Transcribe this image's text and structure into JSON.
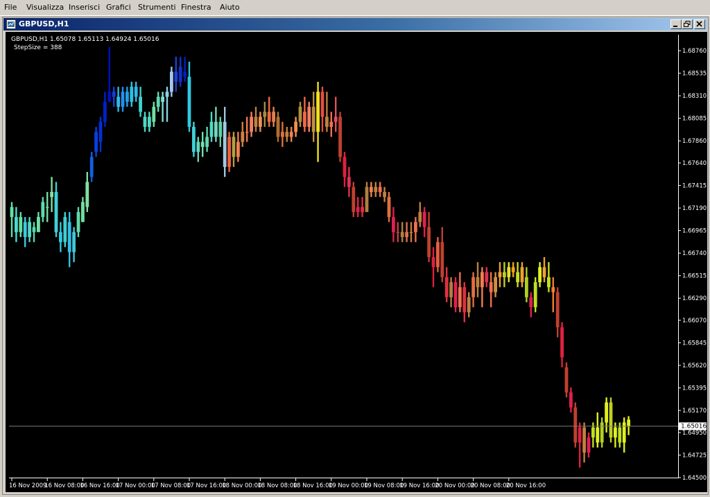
{
  "menu": [
    "File",
    "Visualizza",
    "Inserisci",
    "Grafici",
    "Strumenti",
    "Finestra",
    "Aiuto"
  ],
  "window": {
    "title": "GBPUSD,H1",
    "minimize_icon": "minimize-icon",
    "restore_icon": "restore-icon",
    "close_icon": "close-icon"
  },
  "chart_data": {
    "type": "candlestick",
    "symbol_line": "GBPUSD,H1  1.65078 1.65113 1.64924 1.65016",
    "indicator_line": "StepSize = 388",
    "ylim": [
      1.645,
      1.6892
    ],
    "y_ticks": [
      "1.68760",
      "1.68535",
      "1.68310",
      "1.68085",
      "1.67860",
      "1.67640",
      "1.67415",
      "1.67190",
      "1.66965",
      "1.66740",
      "1.66515",
      "1.66290",
      "1.66070",
      "1.65845",
      "1.65620",
      "1.65395",
      "1.65170",
      "1.64950",
      "1.64725",
      "1.64500"
    ],
    "y_tick_values": [
      1.6876,
      1.68535,
      1.6831,
      1.68085,
      1.6786,
      1.6764,
      1.67415,
      1.6719,
      1.66965,
      1.6674,
      1.66515,
      1.6629,
      1.6607,
      1.65845,
      1.6562,
      1.65395,
      1.6517,
      1.6495,
      1.64725,
      1.645
    ],
    "x_ticks": [
      "16 Nov 2009",
      "16 Nov 08:00",
      "16 Nov 16:00",
      "17 Nov 00:00",
      "17 Nov 08:00",
      "17 Nov 16:00",
      "18 Nov 00:00",
      "18 Nov 08:00",
      "18 Nov 16:00",
      "19 Nov 00:00",
      "19 Nov 08:00",
      "19 Nov 16:00",
      "20 Nov 00:00",
      "20 Nov 08:00",
      "20 Nov 16:00"
    ],
    "bars_per_x_tick": 8,
    "current_price": "1.65016",
    "current_price_value": 1.65016,
    "colors": {
      "background": "#000000",
      "axis": "#ffffff",
      "price_line": "#c0c0c0",
      "price_label_bg": "#ffffff"
    },
    "candles": [
      {
        "o": 1.671,
        "h": 1.6725,
        "l": 1.669,
        "c": 1.672,
        "col": "#5fe0a8"
      },
      {
        "o": 1.671,
        "h": 1.672,
        "l": 1.6685,
        "c": 1.6695,
        "col": "#50d8d0"
      },
      {
        "o": 1.6695,
        "h": 1.6715,
        "l": 1.669,
        "c": 1.671,
        "col": "#60e0a0"
      },
      {
        "o": 1.6705,
        "h": 1.671,
        "l": 1.668,
        "c": 1.669,
        "col": "#40c8e0"
      },
      {
        "o": 1.669,
        "h": 1.671,
        "l": 1.6685,
        "c": 1.6705,
        "col": "#50d8c0"
      },
      {
        "o": 1.67,
        "h": 1.6705,
        "l": 1.6685,
        "c": 1.6695,
        "col": "#58d8b0"
      },
      {
        "o": 1.6695,
        "h": 1.6715,
        "l": 1.6695,
        "c": 1.671,
        "col": "#70e0a0"
      },
      {
        "o": 1.671,
        "h": 1.673,
        "l": 1.6705,
        "c": 1.6725,
        "col": "#60d8b0"
      },
      {
        "o": 1.672,
        "h": 1.6735,
        "l": 1.6705,
        "c": 1.672,
        "col": "#70e0a0"
      },
      {
        "o": 1.673,
        "h": 1.675,
        "l": 1.6715,
        "c": 1.6735,
        "col": "#80e0a0"
      },
      {
        "o": 1.6735,
        "h": 1.6745,
        "l": 1.669,
        "c": 1.6695,
        "col": "#40d0d8"
      },
      {
        "o": 1.6695,
        "h": 1.6705,
        "l": 1.6675,
        "c": 1.6685,
        "col": "#30c8e0"
      },
      {
        "o": 1.6685,
        "h": 1.6715,
        "l": 1.668,
        "c": 1.671,
        "col": "#40d0d0"
      },
      {
        "o": 1.6705,
        "h": 1.6715,
        "l": 1.666,
        "c": 1.6675,
        "col": "#30c0e8"
      },
      {
        "o": 1.6675,
        "h": 1.67,
        "l": 1.6665,
        "c": 1.6695,
        "col": "#40c8d8"
      },
      {
        "o": 1.6695,
        "h": 1.672,
        "l": 1.669,
        "c": 1.6715,
        "col": "#60d8a8"
      },
      {
        "o": 1.6705,
        "h": 1.673,
        "l": 1.6705,
        "c": 1.6725,
        "col": "#70e0a0"
      },
      {
        "o": 1.672,
        "h": 1.6755,
        "l": 1.6715,
        "c": 1.6745,
        "col": "#80e0a0"
      },
      {
        "o": 1.675,
        "h": 1.6775,
        "l": 1.6745,
        "c": 1.677,
        "col": "#1060e0"
      },
      {
        "o": 1.6775,
        "h": 1.68,
        "l": 1.677,
        "c": 1.6795,
        "col": "#0840e0"
      },
      {
        "o": 1.6785,
        "h": 1.681,
        "l": 1.6775,
        "c": 1.6805,
        "col": "#0030d8"
      },
      {
        "o": 1.6805,
        "h": 1.6835,
        "l": 1.68,
        "c": 1.6825,
        "col": "#0020c8"
      },
      {
        "o": 1.6825,
        "h": 1.688,
        "l": 1.6825,
        "c": 1.6835,
        "col": "#0010c0"
      },
      {
        "o": 1.6835,
        "h": 1.684,
        "l": 1.682,
        "c": 1.683,
        "col": "#1040d8"
      },
      {
        "o": 1.683,
        "h": 1.684,
        "l": 1.6815,
        "c": 1.682,
        "col": "#30b8e8"
      },
      {
        "o": 1.682,
        "h": 1.684,
        "l": 1.6815,
        "c": 1.6835,
        "col": "#2090f0"
      },
      {
        "o": 1.6835,
        "h": 1.684,
        "l": 1.682,
        "c": 1.6825,
        "col": "#20a0e8"
      },
      {
        "o": 1.6825,
        "h": 1.6845,
        "l": 1.682,
        "c": 1.684,
        "col": "#30c0e0"
      },
      {
        "o": 1.684,
        "h": 1.6845,
        "l": 1.6825,
        "c": 1.683,
        "col": "#30b8e8"
      },
      {
        "o": 1.683,
        "h": 1.684,
        "l": 1.681,
        "c": 1.6815,
        "col": "#40d0d0"
      },
      {
        "o": 1.681,
        "h": 1.6815,
        "l": 1.6795,
        "c": 1.68,
        "col": "#50d8c0"
      },
      {
        "o": 1.68,
        "h": 1.6815,
        "l": 1.6795,
        "c": 1.681,
        "col": "#50d8c0"
      },
      {
        "o": 1.6805,
        "h": 1.6825,
        "l": 1.68,
        "c": 1.682,
        "col": "#70e0a0"
      },
      {
        "o": 1.682,
        "h": 1.6835,
        "l": 1.6815,
        "c": 1.683,
        "col": "#60d8b0"
      },
      {
        "o": 1.6825,
        "h": 1.6835,
        "l": 1.6805,
        "c": 1.683,
        "col": "#80e0d0"
      },
      {
        "o": 1.683,
        "h": 1.684,
        "l": 1.6805,
        "c": 1.6835,
        "col": "#90d0e8"
      },
      {
        "o": 1.6835,
        "h": 1.686,
        "l": 1.683,
        "c": 1.6855,
        "col": "#a0c8f0"
      },
      {
        "o": 1.6855,
        "h": 1.687,
        "l": 1.6835,
        "c": 1.6845,
        "col": "#2040d0"
      },
      {
        "o": 1.6845,
        "h": 1.687,
        "l": 1.684,
        "c": 1.686,
        "col": "#1030c8"
      },
      {
        "o": 1.6855,
        "h": 1.687,
        "l": 1.6845,
        "c": 1.685,
        "col": "#0020c0"
      },
      {
        "o": 1.685,
        "h": 1.6865,
        "l": 1.6795,
        "c": 1.68,
        "col": "#30c8e0"
      },
      {
        "o": 1.68,
        "h": 1.6805,
        "l": 1.677,
        "c": 1.6775,
        "col": "#40d0d8"
      },
      {
        "o": 1.6775,
        "h": 1.679,
        "l": 1.6765,
        "c": 1.6785,
        "col": "#60d8c0"
      },
      {
        "o": 1.6785,
        "h": 1.6795,
        "l": 1.677,
        "c": 1.678,
        "col": "#70e0b0"
      },
      {
        "o": 1.678,
        "h": 1.68,
        "l": 1.6775,
        "c": 1.679,
        "col": "#60d8b0"
      },
      {
        "o": 1.679,
        "h": 1.6815,
        "l": 1.6785,
        "c": 1.6805,
        "col": "#50d8c0"
      },
      {
        "o": 1.6805,
        "h": 1.682,
        "l": 1.6785,
        "c": 1.679,
        "col": "#70d8c0"
      },
      {
        "o": 1.679,
        "h": 1.681,
        "l": 1.678,
        "c": 1.6805,
        "col": "#60d0a0"
      },
      {
        "o": 1.6805,
        "h": 1.682,
        "l": 1.675,
        "c": 1.676,
        "col": "#a0c8e0"
      },
      {
        "o": 1.676,
        "h": 1.6795,
        "l": 1.6755,
        "c": 1.679,
        "col": "#f06040"
      },
      {
        "o": 1.679,
        "h": 1.6795,
        "l": 1.676,
        "c": 1.677,
        "col": "#b0a040"
      },
      {
        "o": 1.677,
        "h": 1.6795,
        "l": 1.6765,
        "c": 1.6785,
        "col": "#f08050"
      },
      {
        "o": 1.6785,
        "h": 1.6805,
        "l": 1.678,
        "c": 1.6795,
        "col": "#d08040"
      },
      {
        "o": 1.6795,
        "h": 1.681,
        "l": 1.6785,
        "c": 1.6795,
        "col": "#f07850"
      },
      {
        "o": 1.6795,
        "h": 1.6815,
        "l": 1.679,
        "c": 1.681,
        "col": "#f08060"
      },
      {
        "o": 1.681,
        "h": 1.682,
        "l": 1.6795,
        "c": 1.68,
        "col": "#c08040"
      },
      {
        "o": 1.68,
        "h": 1.6815,
        "l": 1.6795,
        "c": 1.681,
        "col": "#f09050"
      },
      {
        "o": 1.681,
        "h": 1.6825,
        "l": 1.68,
        "c": 1.6815,
        "col": "#a09040"
      },
      {
        "o": 1.6815,
        "h": 1.683,
        "l": 1.68,
        "c": 1.6805,
        "col": "#f06840"
      },
      {
        "o": 1.6805,
        "h": 1.682,
        "l": 1.68,
        "c": 1.6815,
        "col": "#e08050"
      },
      {
        "o": 1.681,
        "h": 1.6815,
        "l": 1.6785,
        "c": 1.679,
        "col": "#b07030"
      },
      {
        "o": 1.679,
        "h": 1.6805,
        "l": 1.678,
        "c": 1.6795,
        "col": "#e07040"
      },
      {
        "o": 1.6795,
        "h": 1.68,
        "l": 1.6785,
        "c": 1.679,
        "col": "#c08040"
      },
      {
        "o": 1.679,
        "h": 1.68,
        "l": 1.6785,
        "c": 1.6795,
        "col": "#f08050"
      },
      {
        "o": 1.6795,
        "h": 1.681,
        "l": 1.679,
        "c": 1.6805,
        "col": "#f09050"
      },
      {
        "o": 1.6805,
        "h": 1.6825,
        "l": 1.68,
        "c": 1.682,
        "col": "#b09040"
      },
      {
        "o": 1.6815,
        "h": 1.683,
        "l": 1.6795,
        "c": 1.68,
        "col": "#f06848"
      },
      {
        "o": 1.68,
        "h": 1.6825,
        "l": 1.6795,
        "c": 1.682,
        "col": "#f08060"
      },
      {
        "o": 1.682,
        "h": 1.6835,
        "l": 1.6785,
        "c": 1.6795,
        "col": "#c09040"
      },
      {
        "o": 1.6795,
        "h": 1.6845,
        "l": 1.6765,
        "c": 1.6835,
        "col": "#f0e020"
      },
      {
        "o": 1.6835,
        "h": 1.684,
        "l": 1.6795,
        "c": 1.681,
        "col": "#e05040"
      },
      {
        "o": 1.681,
        "h": 1.6835,
        "l": 1.6795,
        "c": 1.68,
        "col": "#c08040"
      },
      {
        "o": 1.68,
        "h": 1.6815,
        "l": 1.679,
        "c": 1.6805,
        "col": "#f07050"
      },
      {
        "o": 1.6805,
        "h": 1.683,
        "l": 1.6795,
        "c": 1.681,
        "col": "#e05060"
      },
      {
        "o": 1.681,
        "h": 1.6815,
        "l": 1.6765,
        "c": 1.677,
        "col": "#c04030"
      },
      {
        "o": 1.677,
        "h": 1.6775,
        "l": 1.674,
        "c": 1.675,
        "col": "#e02040"
      },
      {
        "o": 1.675,
        "h": 1.676,
        "l": 1.673,
        "c": 1.674,
        "col": "#e03050"
      },
      {
        "o": 1.674,
        "h": 1.6745,
        "l": 1.671,
        "c": 1.6715,
        "col": "#c04030"
      },
      {
        "o": 1.6715,
        "h": 1.673,
        "l": 1.671,
        "c": 1.672,
        "col": "#e02050"
      },
      {
        "o": 1.672,
        "h": 1.673,
        "l": 1.671,
        "c": 1.6715,
        "col": "#e03040"
      },
      {
        "o": 1.6715,
        "h": 1.6745,
        "l": 1.6715,
        "c": 1.674,
        "col": "#b08040"
      },
      {
        "o": 1.674,
        "h": 1.6745,
        "l": 1.673,
        "c": 1.6735,
        "col": "#f08050"
      },
      {
        "o": 1.6735,
        "h": 1.6745,
        "l": 1.673,
        "c": 1.674,
        "col": "#c08040"
      },
      {
        "o": 1.674,
        "h": 1.6745,
        "l": 1.673,
        "c": 1.6735,
        "col": "#f07050"
      },
      {
        "o": 1.6735,
        "h": 1.674,
        "l": 1.6725,
        "c": 1.673,
        "col": "#c08040"
      },
      {
        "o": 1.673,
        "h": 1.6735,
        "l": 1.6705,
        "c": 1.671,
        "col": "#e07040"
      },
      {
        "o": 1.671,
        "h": 1.672,
        "l": 1.6685,
        "c": 1.6695,
        "col": "#e02050"
      },
      {
        "o": 1.6695,
        "h": 1.6705,
        "l": 1.6685,
        "c": 1.6695,
        "col": "#c04040"
      },
      {
        "o": 1.6695,
        "h": 1.6705,
        "l": 1.6685,
        "c": 1.669,
        "col": "#b08040"
      },
      {
        "o": 1.669,
        "h": 1.6705,
        "l": 1.6685,
        "c": 1.6695,
        "col": "#e07050"
      },
      {
        "o": 1.6695,
        "h": 1.6705,
        "l": 1.6685,
        "c": 1.6695,
        "col": "#c08040"
      },
      {
        "o": 1.6695,
        "h": 1.671,
        "l": 1.6685,
        "c": 1.6705,
        "col": "#f07050"
      },
      {
        "o": 1.6705,
        "h": 1.6725,
        "l": 1.67,
        "c": 1.6715,
        "col": "#c08040"
      },
      {
        "o": 1.6715,
        "h": 1.672,
        "l": 1.669,
        "c": 1.67,
        "col": "#e02050"
      },
      {
        "o": 1.67,
        "h": 1.6715,
        "l": 1.6665,
        "c": 1.667,
        "col": "#c04030"
      },
      {
        "o": 1.667,
        "h": 1.668,
        "l": 1.664,
        "c": 1.666,
        "col": "#e02040"
      },
      {
        "o": 1.666,
        "h": 1.669,
        "l": 1.6655,
        "c": 1.6685,
        "col": "#e06040"
      },
      {
        "o": 1.6685,
        "h": 1.67,
        "l": 1.6645,
        "c": 1.665,
        "col": "#c04030"
      },
      {
        "o": 1.665,
        "h": 1.666,
        "l": 1.6625,
        "c": 1.663,
        "col": "#e03040"
      },
      {
        "o": 1.663,
        "h": 1.665,
        "l": 1.662,
        "c": 1.6645,
        "col": "#b08040"
      },
      {
        "o": 1.6645,
        "h": 1.665,
        "l": 1.6615,
        "c": 1.662,
        "col": "#e02050"
      },
      {
        "o": 1.662,
        "h": 1.6655,
        "l": 1.6615,
        "c": 1.664,
        "col": "#f07050"
      },
      {
        "o": 1.664,
        "h": 1.6645,
        "l": 1.6605,
        "c": 1.6615,
        "col": "#e03040"
      },
      {
        "o": 1.6615,
        "h": 1.6635,
        "l": 1.661,
        "c": 1.663,
        "col": "#c08040"
      },
      {
        "o": 1.663,
        "h": 1.6655,
        "l": 1.662,
        "c": 1.665,
        "col": "#e07040"
      },
      {
        "o": 1.665,
        "h": 1.6665,
        "l": 1.663,
        "c": 1.664,
        "col": "#c08040"
      },
      {
        "o": 1.664,
        "h": 1.666,
        "l": 1.662,
        "c": 1.6655,
        "col": "#f08050"
      },
      {
        "o": 1.6655,
        "h": 1.666,
        "l": 1.664,
        "c": 1.6645,
        "col": "#e03050"
      },
      {
        "o": 1.6645,
        "h": 1.6655,
        "l": 1.662,
        "c": 1.6635,
        "col": "#f07050"
      },
      {
        "o": 1.6635,
        "h": 1.6655,
        "l": 1.663,
        "c": 1.665,
        "col": "#d09040"
      },
      {
        "o": 1.665,
        "h": 1.6665,
        "l": 1.664,
        "c": 1.6655,
        "col": "#f0a030"
      },
      {
        "o": 1.6655,
        "h": 1.6665,
        "l": 1.664,
        "c": 1.665,
        "col": "#c0d020"
      },
      {
        "o": 1.665,
        "h": 1.6665,
        "l": 1.6645,
        "c": 1.666,
        "col": "#e0e030"
      },
      {
        "o": 1.666,
        "h": 1.6665,
        "l": 1.665,
        "c": 1.6655,
        "col": "#f0a020"
      },
      {
        "o": 1.6655,
        "h": 1.6665,
        "l": 1.664,
        "c": 1.6645,
        "col": "#c0e020"
      },
      {
        "o": 1.6645,
        "h": 1.6665,
        "l": 1.664,
        "c": 1.666,
        "col": "#f0a030"
      },
      {
        "o": 1.665,
        "h": 1.666,
        "l": 1.6625,
        "c": 1.663,
        "col": "#b0d020"
      },
      {
        "o": 1.663,
        "h": 1.6635,
        "l": 1.661,
        "c": 1.662,
        "col": "#e02050"
      },
      {
        "o": 1.662,
        "h": 1.665,
        "l": 1.6615,
        "c": 1.6645,
        "col": "#c0e020"
      },
      {
        "o": 1.6645,
        "h": 1.6665,
        "l": 1.664,
        "c": 1.666,
        "col": "#e0f020"
      },
      {
        "o": 1.666,
        "h": 1.667,
        "l": 1.6645,
        "c": 1.665,
        "col": "#f0a030"
      },
      {
        "o": 1.665,
        "h": 1.6665,
        "l": 1.6635,
        "c": 1.664,
        "col": "#c0e020"
      },
      {
        "o": 1.664,
        "h": 1.665,
        "l": 1.6615,
        "c": 1.6635,
        "col": "#f08030"
      },
      {
        "o": 1.6635,
        "h": 1.664,
        "l": 1.659,
        "c": 1.66,
        "col": "#c04030"
      },
      {
        "o": 1.66,
        "h": 1.6605,
        "l": 1.656,
        "c": 1.657,
        "col": "#e02040"
      },
      {
        "o": 1.656,
        "h": 1.6565,
        "l": 1.653,
        "c": 1.6535,
        "col": "#c04030"
      },
      {
        "o": 1.6535,
        "h": 1.654,
        "l": 1.6515,
        "c": 1.652,
        "col": "#e02050"
      },
      {
        "o": 1.652,
        "h": 1.6525,
        "l": 1.648,
        "c": 1.6485,
        "col": "#c04030"
      },
      {
        "o": 1.6485,
        "h": 1.6505,
        "l": 1.646,
        "c": 1.65,
        "col": "#e02040"
      },
      {
        "o": 1.65,
        "h": 1.6505,
        "l": 1.6465,
        "c": 1.6475,
        "col": "#c08040"
      },
      {
        "o": 1.6475,
        "h": 1.6495,
        "l": 1.647,
        "c": 1.649,
        "col": "#e02050"
      },
      {
        "o": 1.649,
        "h": 1.6505,
        "l": 1.648,
        "c": 1.65,
        "col": "#c0e020"
      },
      {
        "o": 1.65,
        "h": 1.6515,
        "l": 1.648,
        "c": 1.6485,
        "col": "#e0f020"
      },
      {
        "o": 1.6485,
        "h": 1.651,
        "l": 1.648,
        "c": 1.6505,
        "col": "#b0d020"
      },
      {
        "o": 1.6505,
        "h": 1.653,
        "l": 1.6495,
        "c": 1.6525,
        "col": "#e0f020"
      },
      {
        "o": 1.6525,
        "h": 1.653,
        "l": 1.6485,
        "c": 1.649,
        "col": "#c0d020"
      },
      {
        "o": 1.649,
        "h": 1.6505,
        "l": 1.648,
        "c": 1.65,
        "col": "#e0f020"
      },
      {
        "o": 1.65,
        "h": 1.6505,
        "l": 1.648,
        "c": 1.6485,
        "col": "#c0e020"
      },
      {
        "o": 1.6485,
        "h": 1.651,
        "l": 1.6475,
        "c": 1.6505,
        "col": "#e0f020"
      },
      {
        "o": 1.65078,
        "h": 1.65113,
        "l": 1.64924,
        "c": 1.65016,
        "col": "#e0f020"
      }
    ]
  }
}
